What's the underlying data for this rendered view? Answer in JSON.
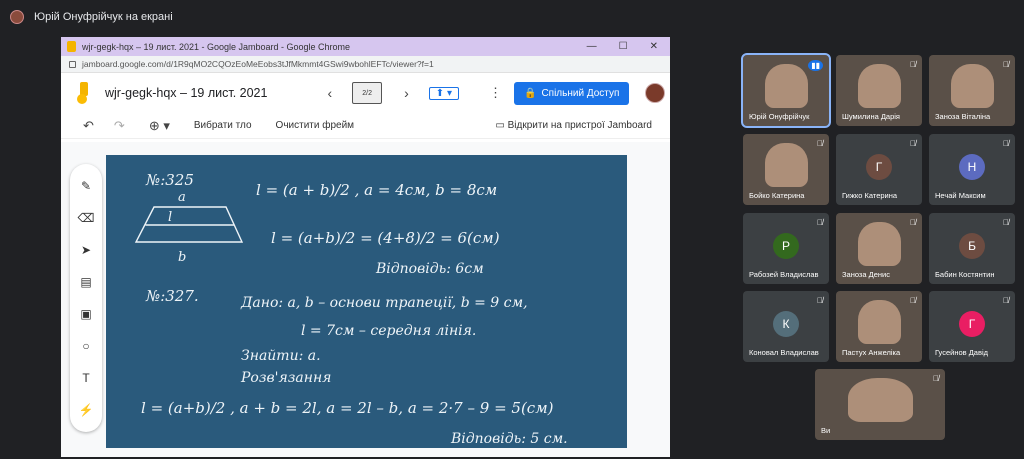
{
  "meet": {
    "presenting_text": "Юрій Онуфрійчук на екрані",
    "participants": [
      {
        "name": "Юрій Онуфрійчук",
        "mic": "speaking",
        "video": true
      },
      {
        "name": "Шумилина Дарія",
        "mic": "muted",
        "video": true
      },
      {
        "name": "Заноза Віталіна",
        "mic": "muted",
        "video": true
      },
      {
        "name": "Бойко Катерина",
        "mic": "muted",
        "video": true
      },
      {
        "name": "Гижко Катерина",
        "mic": "muted",
        "initial": "Г",
        "color": "#6d4c41"
      },
      {
        "name": "Нечай Максим",
        "mic": "muted",
        "initial": "Н",
        "color": "#5c6bc0"
      },
      {
        "name": "Рабозей Владислав",
        "mic": "muted",
        "initial": "Р",
        "color": "#33691e"
      },
      {
        "name": "Заноза Денис",
        "mic": "muted",
        "video": true
      },
      {
        "name": "Бабин Костянтин",
        "mic": "muted",
        "initial": "Б",
        "color": "#6d4c41"
      },
      {
        "name": "Коновал Владислав",
        "mic": "muted",
        "initial": "К",
        "color": "#546e7a"
      },
      {
        "name": "Пастух Анжеліка",
        "mic": "muted",
        "video": true
      },
      {
        "name": "Гусейнов Давід",
        "mic": "muted",
        "initial": "Г",
        "color": "#e91e63"
      },
      {
        "name": "Ви",
        "mic": "muted",
        "video": true
      }
    ]
  },
  "browser": {
    "title": "wjr-gegk-hqx – 19 лист. 2021 - Google Jamboard - Google Chrome",
    "url": "jamboard.google.com/d/1R9qMO2CQOzEoMeEobs3tJfMkmmt4GSwi9wbohlEFTc/viewer?f=1"
  },
  "jamboard": {
    "title": "wjr-gegk-hqx – 19 лист. 2021",
    "frame": "2/2",
    "share_label": "Спільний Доступ",
    "select_bg": "Вибрати тло",
    "clear_frame": "Очистити фрейм",
    "open_device": "Відкрити на пристрої Jamboard"
  },
  "board": {
    "p325": {
      "label": "№:325",
      "a": "a",
      "l": "l",
      "b": "b",
      "formula": "l = (a + b)/2 ,  a = 4см,  b = 8см",
      "eq2": "l = (a+b)/2 = (4+8)/2 = 6(см)",
      "answer": "Відповідь: 6см"
    },
    "p327": {
      "label": "№:327.",
      "given1": "Дано: a, b – основи трапеції, b = 9 см,",
      "given2": "l = 7см – середня лінія.",
      "find": "Знайти: a.",
      "solution": "Розв'язання",
      "eq": "l = (a+b)/2 ,  a + b = 2l,  a = 2l – b,  a = 2·7 – 9 = 5(см)",
      "answer": "Відповідь: 5 см."
    }
  }
}
